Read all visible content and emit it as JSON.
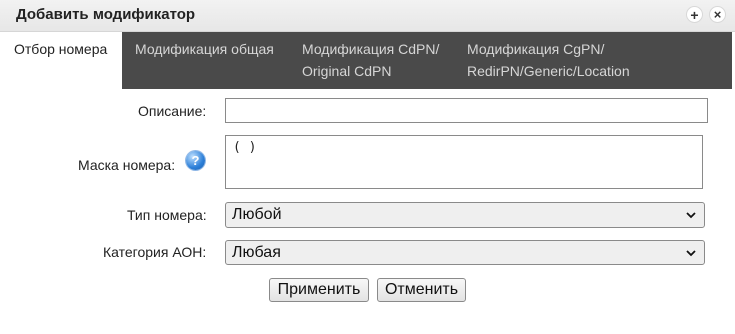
{
  "dialog": {
    "title": "Добавить модификатор",
    "plus_symbol": "+",
    "close_symbol": "×"
  },
  "tabs": [
    {
      "label_line1": "Отбор номера",
      "label_line2": ""
    },
    {
      "label_line1": "Модификация общая",
      "label_line2": ""
    },
    {
      "label_line1": "Модификация CdPN/",
      "label_line2": "Original CdPN"
    },
    {
      "label_line1": "Модификация CgPN/",
      "label_line2": "RedirPN/Generic/Location"
    }
  ],
  "form": {
    "description_label": "Описание:",
    "description_value": "",
    "mask_label": "Маска номера:",
    "mask_value": "( )",
    "help_symbol": "?",
    "number_type_label": "Тип номера:",
    "number_type_value": "Любой",
    "aon_category_label": "Категория АОН:",
    "aon_category_value": "Любая"
  },
  "buttons": {
    "apply": "Применить",
    "cancel": "Отменить"
  },
  "icons": {
    "plus": "plus-icon",
    "close": "close-icon",
    "help": "help-icon",
    "chevron": "chevron-down-icon"
  }
}
